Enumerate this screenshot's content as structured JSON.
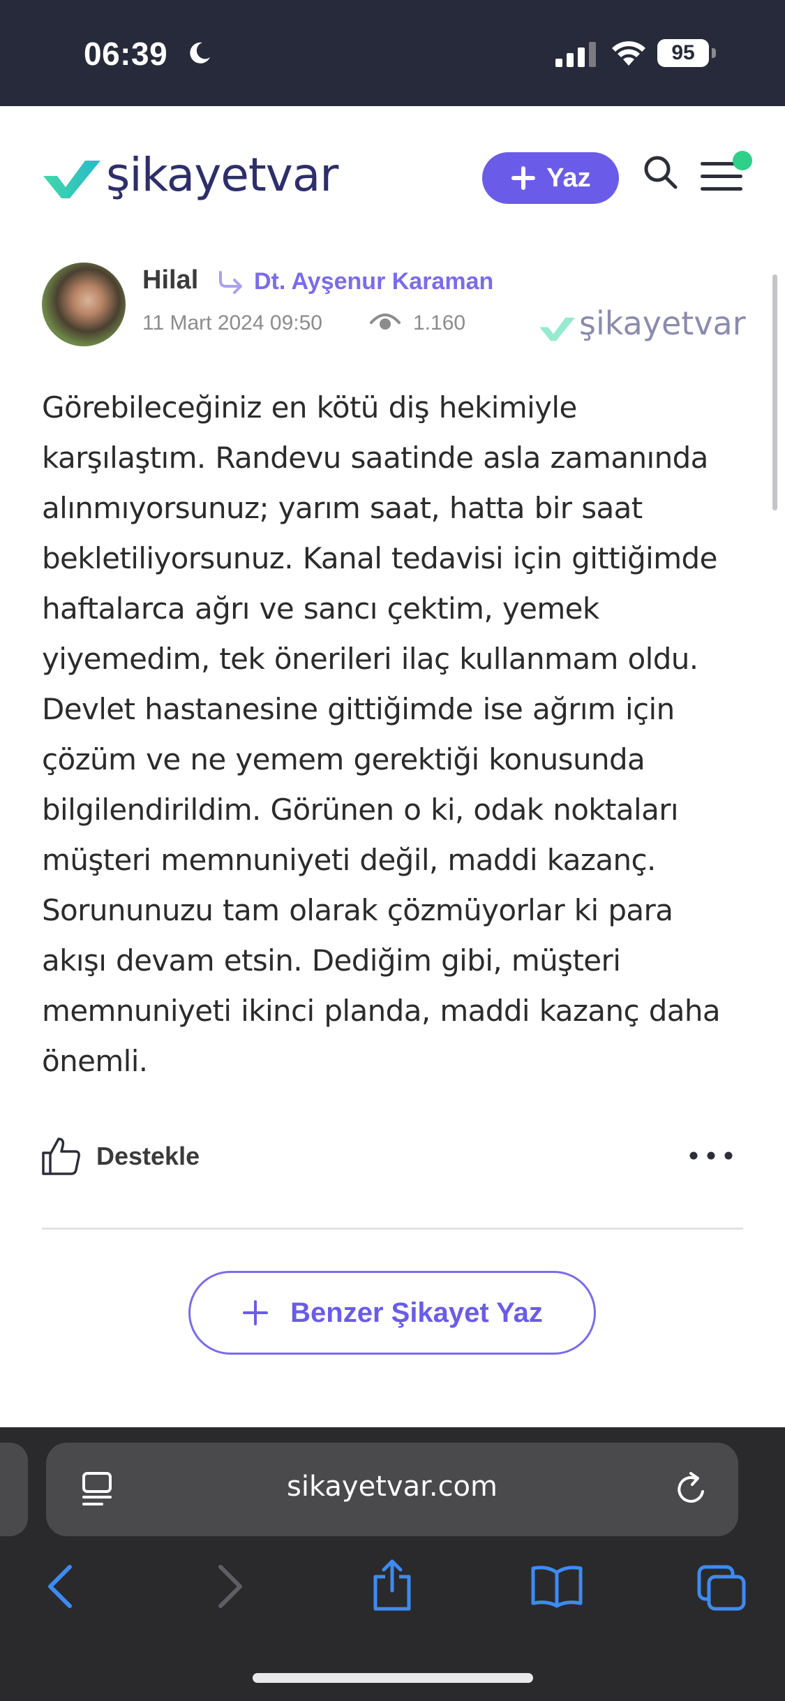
{
  "status_bar": {
    "time": "06:39",
    "battery": "95"
  },
  "header": {
    "logo_text": "şikayetvar",
    "write_label": "Yaz"
  },
  "post": {
    "author": "Hilal",
    "company": "Dt. Ayşenur Karaman",
    "date": "11 Mart 2024 09:50",
    "views": "1.160",
    "watermark": "şikayetvar",
    "body": "Görebileceğiniz en kötü diş hekimiyle karşılaştım. Randevu saatinde asla zamanında alınmıyorsunuz; yarım saat, hatta bir saat bekletiliyorsunuz. Kanal tedavisi için gittiğimde haftalarca ağrı ve sancı çektim, yemek yiyemedim, tek önerileri ilaç kullanmam oldu. Devlet hastanesine gittiğimde ise ağrım için çözüm ve ne yemem gerektiği konusunda bilgilendirildim. Görünen o ki, odak noktaları müşteri memnuniyeti değil, maddi kazanç. Sorununuzu tam olarak çözmüyorlar ki para akışı devam etsin. Dediğim gibi, müşteri memnuniyeti ikinci planda, maddi kazanç daha önemli.",
    "support_label": "Destekle"
  },
  "actions": {
    "similar_label": "Benzer Şikayet Yaz"
  },
  "browser": {
    "url": "sikayetvar.com"
  },
  "colors": {
    "brand_purple": "#6a5ce8",
    "brand_green": "#2ed08a",
    "status_bar_bg": "#272a3a",
    "browser_bg": "#2a2a2c"
  }
}
